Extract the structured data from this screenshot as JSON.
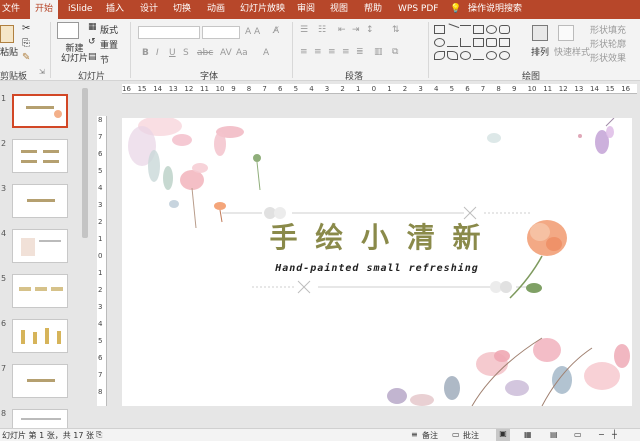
{
  "tabs": [
    "文件",
    "开始",
    "iSlide",
    "插入",
    "设计",
    "切换",
    "动画",
    "幻灯片放映",
    "审阅",
    "视图",
    "帮助",
    "WPS PDF",
    "操作说明搜索"
  ],
  "active_tab": "开始",
  "ribbon": {
    "paste": "粘贴",
    "new_slide": "新建\n幻灯片",
    "layout": "版式",
    "reset": "重置",
    "section": "节",
    "clipboard_group": "剪贴板",
    "slides_group": "幻灯片",
    "font_group": "字体",
    "paragraph_group": "段落",
    "drawing_group": "绘图",
    "arrange": "排列",
    "quick_styles": "快速样式",
    "shape_fill": "形状填充",
    "shape_outline": "形状轮廓",
    "shape_effects": "形状效果",
    "font_size_label": "A A",
    "clear": "Aa"
  },
  "slide": {
    "title": "手 绘 小 清 新",
    "subtitle": "Hand-painted small refreshing"
  },
  "thumbnails": [
    {
      "num": "1",
      "selected": true
    },
    {
      "num": "2",
      "selected": false
    },
    {
      "num": "3",
      "selected": false
    },
    {
      "num": "4",
      "selected": false
    },
    {
      "num": "5",
      "selected": false
    },
    {
      "num": "6",
      "selected": false
    },
    {
      "num": "7",
      "selected": false
    },
    {
      "num": "8",
      "selected": false
    }
  ],
  "ruler": {
    "h_ticks": [
      "16",
      "15",
      "14",
      "13",
      "12",
      "11",
      "10",
      "9",
      "8",
      "7",
      "6",
      "5",
      "4",
      "3",
      "2",
      "1",
      "0",
      "1",
      "2",
      "3",
      "4",
      "5",
      "6",
      "7",
      "8",
      "9",
      "10",
      "11",
      "12",
      "13",
      "14",
      "15",
      "16"
    ],
    "v_ticks": [
      "8",
      "7",
      "6",
      "5",
      "4",
      "3",
      "2",
      "1",
      "0",
      "1",
      "2",
      "3",
      "4",
      "5",
      "6",
      "7",
      "8"
    ]
  },
  "status": {
    "slide_info": "幻灯片 第 1 张，共 17 张",
    "notes": "备注",
    "comments": "批注"
  },
  "colors": {
    "brand": "#b7472a",
    "title_color": "#8a8a4a",
    "selected_border": "#d24726"
  }
}
